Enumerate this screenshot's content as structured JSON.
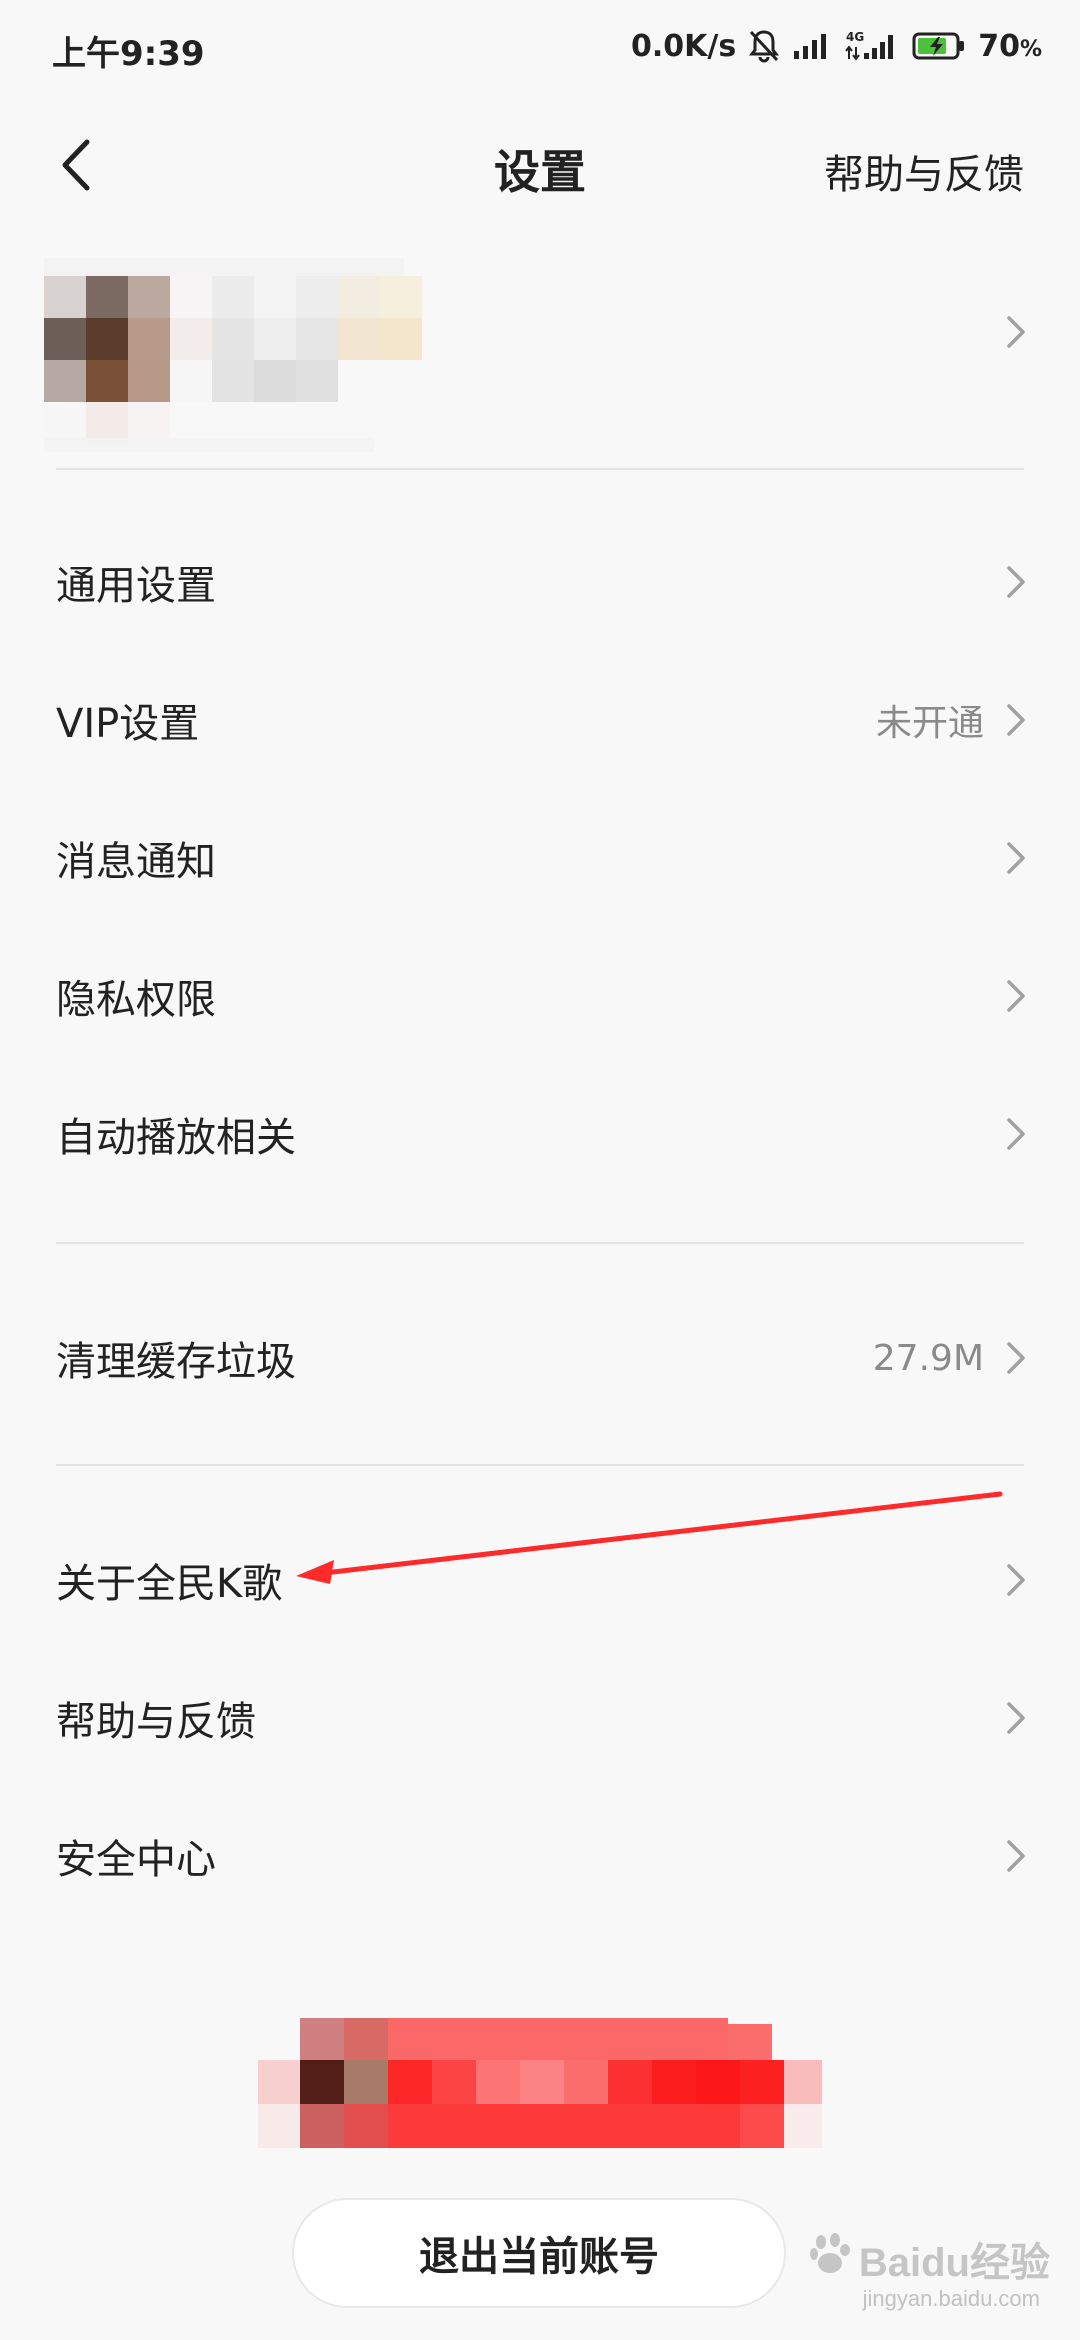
{
  "status_bar": {
    "time": "上午9:39",
    "network_speed": "0.0K/s",
    "network_type": "4G",
    "battery": "70",
    "battery_unit": "%"
  },
  "header": {
    "back_icon": "chevron-left-icon",
    "title": "设置",
    "help_link": "帮助与反馈"
  },
  "settings": {
    "group1": [
      {
        "label": "通用设置",
        "value": ""
      },
      {
        "label": "VIP设置",
        "value": "未开通"
      },
      {
        "label": "消息通知",
        "value": ""
      },
      {
        "label": "隐私权限",
        "value": ""
      },
      {
        "label": "自动播放相关",
        "value": ""
      }
    ],
    "group2": [
      {
        "label": "清理缓存垃圾",
        "value": "27.9M"
      }
    ],
    "group3": [
      {
        "label": "关于全民K歌",
        "value": ""
      },
      {
        "label": "帮助与反馈",
        "value": ""
      },
      {
        "label": "安全中心",
        "value": ""
      }
    ]
  },
  "logout_button": "退出当前账号",
  "watermark": {
    "text": "Baidu经验",
    "url": "jingyan.baidu.com"
  },
  "colors": {
    "background": "#f8f8f8",
    "annotation_arrow": "#ff2a2a",
    "chevron": "#a0a0a0"
  }
}
